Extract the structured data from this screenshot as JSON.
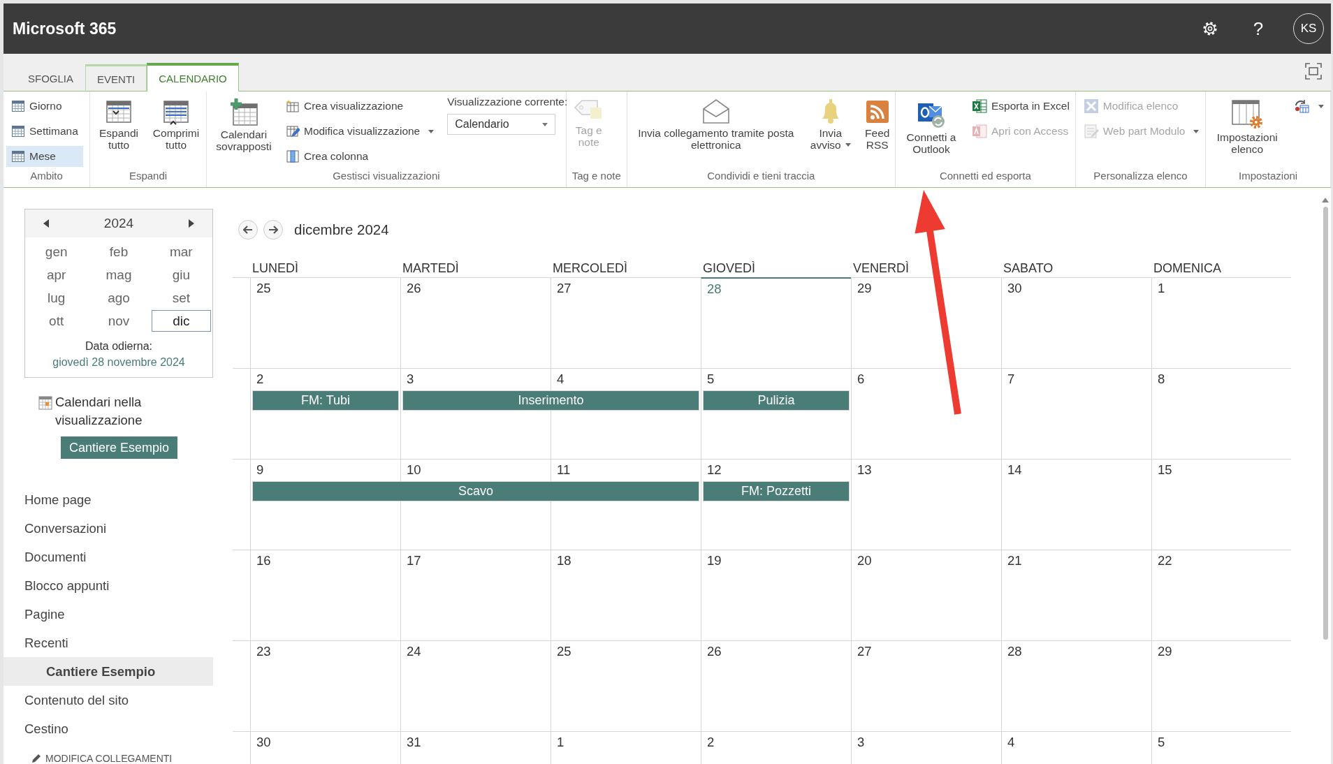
{
  "app_bar": {
    "title": "Microsoft 365",
    "help": "?",
    "avatar": "KS"
  },
  "tabs": [
    {
      "label": "SFOGLIA",
      "selected": false
    },
    {
      "label": "EVENTI",
      "selected": false
    },
    {
      "label": "CALENDARIO",
      "selected": true
    }
  ],
  "ribbon": {
    "groups": [
      {
        "label": "Ambito",
        "buttons": [
          {
            "kind": "small",
            "label": "Giorno",
            "selected": false,
            "disabled": false,
            "dropdown": false
          },
          {
            "kind": "small",
            "label": "Settimana",
            "selected": false,
            "disabled": false,
            "dropdown": false
          },
          {
            "kind": "small",
            "label": "Mese",
            "selected": true,
            "disabled": false,
            "dropdown": false
          }
        ]
      },
      {
        "label": "Espandi",
        "buttons": [
          {
            "kind": "large",
            "label": "Espandi tutto",
            "disabled": false,
            "dropdown": false
          },
          {
            "kind": "large",
            "label": "Comprimi tutto",
            "disabled": false,
            "dropdown": false
          }
        ]
      },
      {
        "label": "Gestisci visualizzazioni",
        "buttons": [
          {
            "kind": "large",
            "label": "Calendari sovrapposti",
            "disabled": false,
            "dropdown": false
          },
          {
            "kind": "small",
            "label": "Crea visualizzazione",
            "disabled": false,
            "dropdown": false
          },
          {
            "kind": "small",
            "label": "Modifica visualizzazione",
            "disabled": false,
            "dropdown": true
          },
          {
            "kind": "small",
            "label": "Crea colonna",
            "disabled": false,
            "dropdown": false
          }
        ],
        "current_view": {
          "label": "Visualizzazione corrente:",
          "value": "Calendario"
        }
      },
      {
        "label": "Tag e note",
        "buttons": [
          {
            "kind": "large",
            "label": "Tag e note",
            "disabled": true,
            "dropdown": false
          }
        ]
      },
      {
        "label": "Condividi e tieni traccia",
        "buttons": [
          {
            "kind": "large",
            "label": "Invia collegamento tramite posta elettronica",
            "disabled": false,
            "dropdown": false
          },
          {
            "kind": "large",
            "label": "Invia avviso",
            "disabled": false,
            "dropdown": true
          },
          {
            "kind": "large",
            "label": "Feed RSS",
            "disabled": false,
            "dropdown": false
          }
        ]
      },
      {
        "label": "Connetti ed esporta",
        "buttons": [
          {
            "kind": "large",
            "label": "Connetti a Outlook",
            "disabled": false,
            "dropdown": false
          },
          {
            "kind": "small",
            "label": "Esporta in Excel",
            "disabled": false,
            "dropdown": false
          },
          {
            "kind": "small",
            "label": "Apri con Access",
            "disabled": true,
            "dropdown": false
          }
        ]
      },
      {
        "label": "Personalizza elenco",
        "buttons": [
          {
            "kind": "small",
            "label": "Modifica elenco",
            "disabled": true,
            "dropdown": false
          },
          {
            "kind": "small",
            "label": "Web part Modulo",
            "disabled": true,
            "dropdown": true
          }
        ]
      },
      {
        "label": "Impostazioni",
        "buttons": [
          {
            "kind": "large",
            "label": "Impostazioni elenco",
            "disabled": false,
            "dropdown": false
          },
          {
            "kind": "small",
            "disabled": false,
            "dropdown": true
          }
        ]
      }
    ]
  },
  "date_picker": {
    "year": "2024",
    "months": [
      {
        "label": "gen",
        "selected": false
      },
      {
        "label": "feb",
        "selected": false
      },
      {
        "label": "mar",
        "selected": false
      },
      {
        "label": "apr",
        "selected": false
      },
      {
        "label": "mag",
        "selected": false
      },
      {
        "label": "giu",
        "selected": false
      },
      {
        "label": "lug",
        "selected": false
      },
      {
        "label": "ago",
        "selected": false
      },
      {
        "label": "set",
        "selected": false
      },
      {
        "label": "ott",
        "selected": false
      },
      {
        "label": "nov",
        "selected": false
      },
      {
        "label": "dic",
        "selected": true
      }
    ],
    "today_label": "Data odierna:",
    "today_link": "giovedì 28 novembre 2024"
  },
  "calendars_in_view": {
    "heading": "Calendari nella visualizzazione",
    "calendars": [
      "Cantiere Esempio"
    ]
  },
  "nav": {
    "items": [
      {
        "label": "Home page",
        "selected": false
      },
      {
        "label": "Conversazioni",
        "selected": false
      },
      {
        "label": "Documenti",
        "selected": false
      },
      {
        "label": "Blocco appunti",
        "selected": false
      },
      {
        "label": "Pagine",
        "selected": false
      },
      {
        "label": "Recenti",
        "selected": false,
        "children": [
          {
            "label": "Cantiere Esempio",
            "selected": true
          }
        ]
      },
      {
        "label": "Contenuto del sito",
        "selected": false
      },
      {
        "label": "Cestino",
        "selected": false
      }
    ],
    "edit_links": "MODIFICA COLLEGAMENTI"
  },
  "calendar": {
    "title": "dicembre 2024",
    "weekdays": [
      "LUNEDÌ",
      "MARTEDÌ",
      "MERCOLEDÌ",
      "GIOVEDÌ",
      "VENERDÌ",
      "SABATO",
      "DOMENICA"
    ],
    "weeks": [
      {
        "days": [
          {
            "day": "25",
            "today": false,
            "continues": false
          },
          {
            "day": "26",
            "today": false,
            "continues": false
          },
          {
            "day": "27",
            "today": false,
            "continues": false
          },
          {
            "day": "28",
            "today": true,
            "continues": false
          },
          {
            "day": "29",
            "today": false,
            "continues": false
          },
          {
            "day": "30",
            "today": false,
            "continues": false
          },
          {
            "day": "1",
            "today": false,
            "continues": false
          }
        ]
      },
      {
        "days": [
          {
            "day": "2",
            "today": false,
            "continues": false,
            "event": "FM: Tubi"
          },
          {
            "day": "3",
            "today": false,
            "continues": false,
            "event": "Inserimento"
          },
          {
            "day": "4",
            "today": false,
            "continues": true
          },
          {
            "day": "5",
            "today": false,
            "continues": false,
            "event": "Pulizia"
          },
          {
            "day": "6",
            "today": false,
            "continues": false
          },
          {
            "day": "7",
            "today": false,
            "continues": false
          },
          {
            "day": "8",
            "today": false,
            "continues": false
          }
        ]
      },
      {
        "days": [
          {
            "day": "9",
            "today": false,
            "continues": false,
            "event": "Scavo"
          },
          {
            "day": "10",
            "today": false,
            "continues": true
          },
          {
            "day": "11",
            "today": false,
            "continues": true
          },
          {
            "day": "12",
            "today": false,
            "continues": false,
            "event": "FM: Pozzetti"
          },
          {
            "day": "13",
            "today": false,
            "continues": false
          },
          {
            "day": "14",
            "today": false,
            "continues": false
          },
          {
            "day": "15",
            "today": false,
            "continues": false
          }
        ]
      },
      {
        "days": [
          {
            "day": "16",
            "today": false,
            "continues": false
          },
          {
            "day": "17",
            "today": false,
            "continues": false
          },
          {
            "day": "18",
            "today": false,
            "continues": false
          },
          {
            "day": "19",
            "today": false,
            "continues": false
          },
          {
            "day": "20",
            "today": false,
            "continues": false
          },
          {
            "day": "21",
            "today": false,
            "continues": false
          },
          {
            "day": "22",
            "today": false,
            "continues": false
          }
        ]
      },
      {
        "days": [
          {
            "day": "23",
            "today": false,
            "continues": false
          },
          {
            "day": "24",
            "today": false,
            "continues": false
          },
          {
            "day": "25",
            "today": false,
            "continues": false
          },
          {
            "day": "26",
            "today": false,
            "continues": false
          },
          {
            "day": "27",
            "today": false,
            "continues": false
          },
          {
            "day": "28",
            "today": false,
            "continues": false
          },
          {
            "day": "29",
            "today": false,
            "continues": false
          }
        ]
      },
      {
        "days": [
          {
            "day": "30",
            "today": false,
            "continues": false
          },
          {
            "day": "31",
            "today": false,
            "continues": false
          },
          {
            "day": "1",
            "today": false,
            "continues": false
          },
          {
            "day": "2",
            "today": false,
            "continues": false
          },
          {
            "day": "3",
            "today": false,
            "continues": false
          },
          {
            "day": "4",
            "today": false,
            "continues": false
          },
          {
            "day": "5",
            "today": false,
            "continues": false
          }
        ]
      }
    ]
  }
}
